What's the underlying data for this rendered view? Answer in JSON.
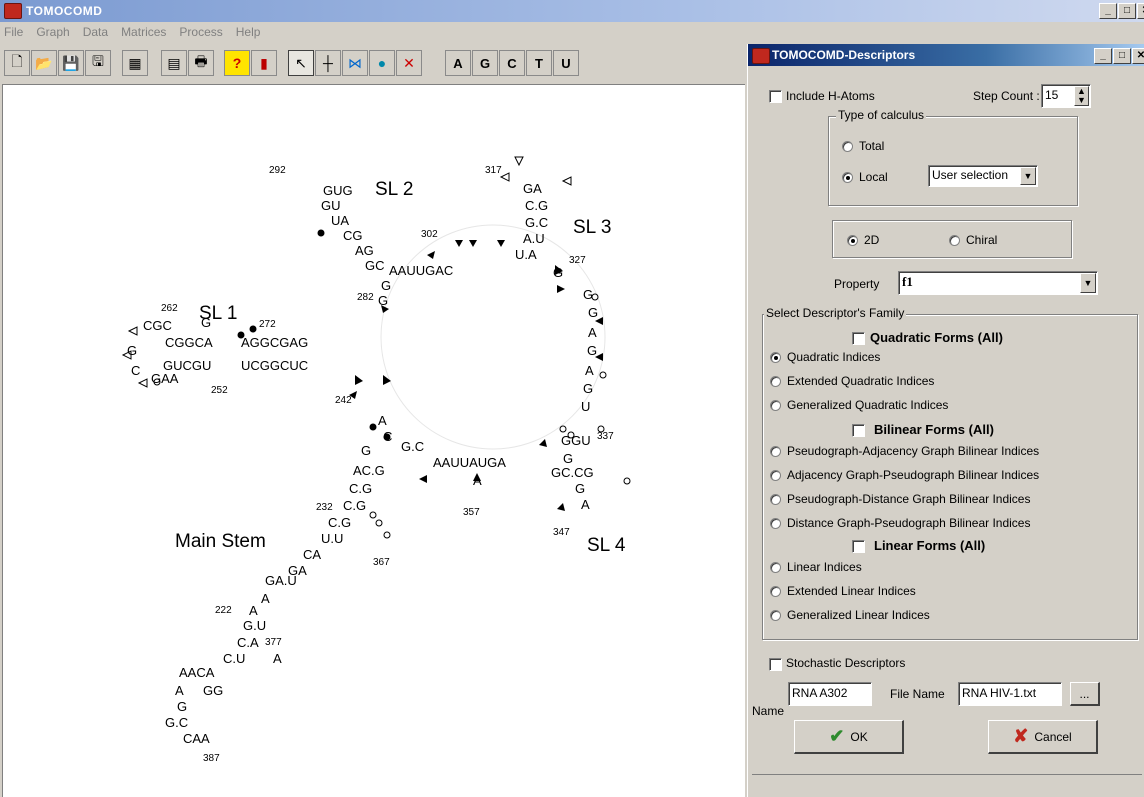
{
  "window": {
    "title": "TOMOCOMD"
  },
  "menu": [
    "File",
    "Graph",
    "Data",
    "Matrices",
    "Process",
    "Help"
  ],
  "toolbar": {
    "nucleotides": [
      "A",
      "G",
      "C",
      "T",
      "U"
    ],
    "icons": [
      "new-file-icon",
      "open-folder-icon",
      "save-disk-icon",
      "save-as-icon",
      "calculator-grid-icon",
      "calculator-icon",
      "print-icon",
      "help-icon",
      "exit-door-icon",
      "pointer-arrow-icon",
      "crosshair-icon",
      "bond-draw-icon",
      "atom-draw-icon",
      "delete-icon"
    ]
  },
  "structure": {
    "stem_labels": [
      "SL 1",
      "SL 2",
      "SL 3",
      "SL 4",
      "Main Stem"
    ],
    "positions": [
      "292",
      "317",
      "302",
      "327",
      "262",
      "272",
      "282",
      "252",
      "242",
      "337",
      "232",
      "357",
      "347",
      "367",
      "222",
      "377",
      "387"
    ]
  },
  "dialog": {
    "title": "TOMOCOMD-Descriptors",
    "include_h_atoms": "Include H-Atoms",
    "step_count_label": "Step Count :",
    "step_count_value": "15",
    "type_of_calculus": {
      "label": "Type of calculus",
      "total": "Total",
      "local": "Local",
      "local_selection": "User selection",
      "selected": "Local"
    },
    "dimension": {
      "option_2d": "2D",
      "option_chiral": "Chiral",
      "selected": "2D"
    },
    "property_label": "Property",
    "property_value": "f1",
    "family": {
      "label": "Select Descriptor's Family",
      "quadratic_header": "Quadratic Forms (All)",
      "quadratic": [
        "Quadratic Indices",
        "Extended Quadratic Indices",
        "Generalized Quadratic Indices"
      ],
      "bilinear_header": "Bilinear Forms (All)",
      "bilinear": [
        "Pseudograph-Adjacency Graph Bilinear Indices",
        "Adjacency Graph-Pseudograph Bilinear Indices",
        "Pseudograph-Distance Graph Bilinear Indices",
        "Distance Graph-Pseudograph Bilinear Indices"
      ],
      "linear_header": "Linear Forms (All)",
      "linear": [
        "Linear Indices",
        "Extended Linear Indices",
        "Generalized Linear Indices"
      ],
      "selected": "Quadratic Indices"
    },
    "stochastic": "Stochastic Descriptors",
    "name_label": "Name",
    "name_value": "RNA A302",
    "file_name_label": "File Name",
    "file_name_value": "RNA HIV-1.txt",
    "browse_label": "...",
    "ok_label": "OK",
    "cancel_label": "Cancel"
  },
  "colors": {
    "title_active": "#0a246a",
    "title_inactive": "#7b9ad1",
    "face": "#d4d0c8",
    "ok_check": "#2e8b2e",
    "cancel_x": "#c0281e"
  }
}
